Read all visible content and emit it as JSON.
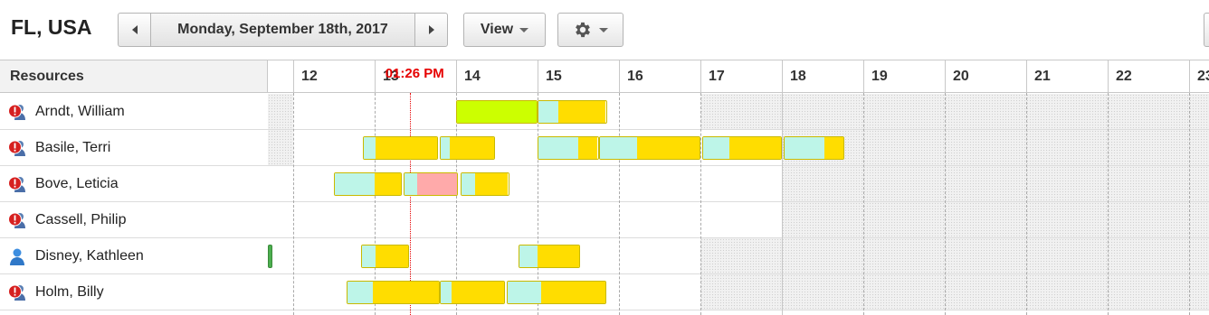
{
  "toolbar": {
    "location_title": "FL, USA",
    "prev_icon": "chevron-left-icon",
    "date_label": "Monday, September 18th, 2017",
    "next_icon": "chevron-right-icon",
    "view_label": "View",
    "settings_icon": "gear-icon"
  },
  "scheduler": {
    "resources_header": "Resources",
    "hours": [
      "12",
      "13",
      "14",
      "15",
      "16",
      "17",
      "18",
      "19",
      "20",
      "21",
      "22",
      "23"
    ],
    "now_label": "01:26 PM",
    "now_hour": 13.43,
    "colors": {
      "travel": "#bdf5e8",
      "work": "#ffdd00",
      "done": "#ccff00",
      "alert": "#ffaaaa",
      "marker": "#4caf50",
      "offhours": "#f1f1f1",
      "now_line": "#e60000"
    },
    "resources": [
      {
        "name": "Arndt, William",
        "icon": "alert-user-icon",
        "offhours": [
          [
            11.68,
            12.0
          ],
          [
            17.0,
            23.4
          ]
        ],
        "events": [
          {
            "start": 14.0,
            "end": 15.0,
            "parts": [
              {
                "kind": "done",
                "frac": 1.0
              }
            ]
          },
          {
            "start": 15.0,
            "end": 15.85,
            "parts": [
              {
                "kind": "travel",
                "frac": 0.29
              },
              {
                "kind": "work",
                "frac": 0.71
              }
            ]
          }
        ]
      },
      {
        "name": "Basile, Terri",
        "icon": "alert-user-icon",
        "offhours": [
          [
            11.68,
            12.0
          ],
          [
            18.0,
            23.4
          ]
        ],
        "events": [
          {
            "start": 12.85,
            "end": 13.78,
            "parts": [
              {
                "kind": "travel",
                "frac": 0.16
              },
              {
                "kind": "work",
                "frac": 0.84
              }
            ]
          },
          {
            "start": 13.8,
            "end": 14.48,
            "parts": [
              {
                "kind": "travel",
                "frac": 0.17
              },
              {
                "kind": "work",
                "frac": 0.83
              }
            ]
          },
          {
            "start": 15.0,
            "end": 15.75,
            "parts": [
              {
                "kind": "travel",
                "frac": 0.67
              },
              {
                "kind": "work",
                "frac": 0.33
              }
            ]
          },
          {
            "start": 15.75,
            "end": 17.0,
            "parts": [
              {
                "kind": "travel",
                "frac": 0.38
              },
              {
                "kind": "work",
                "frac": 0.62
              }
            ]
          },
          {
            "start": 17.02,
            "end": 18.0,
            "parts": [
              {
                "kind": "travel",
                "frac": 0.34
              },
              {
                "kind": "work",
                "frac": 0.66
              }
            ]
          },
          {
            "start": 18.02,
            "end": 18.77,
            "parts": [
              {
                "kind": "travel",
                "frac": 0.68
              },
              {
                "kind": "work",
                "frac": 0.32
              }
            ]
          }
        ]
      },
      {
        "name": "Bove, Leticia",
        "icon": "alert-user-icon",
        "offhours": [
          [
            18.0,
            23.4
          ]
        ],
        "events": [
          {
            "start": 12.5,
            "end": 13.33,
            "parts": [
              {
                "kind": "travel",
                "frac": 0.6
              },
              {
                "kind": "work",
                "frac": 0.4
              }
            ]
          },
          {
            "start": 13.35,
            "end": 14.02,
            "parts": [
              {
                "kind": "travel",
                "frac": 0.25
              },
              {
                "kind": "alert",
                "frac": 0.75
              }
            ]
          },
          {
            "start": 14.05,
            "end": 14.65,
            "parts": [
              {
                "kind": "travel",
                "frac": 0.3
              },
              {
                "kind": "work",
                "frac": 0.7
              }
            ]
          }
        ]
      },
      {
        "name": "Cassell, Philip",
        "icon": "alert-user-icon",
        "offhours": [
          [
            18.0,
            23.4
          ]
        ],
        "events": []
      },
      {
        "name": "Disney, Kathleen",
        "icon": "user-icon",
        "offhours": [
          [
            17.0,
            23.4
          ]
        ],
        "events": [
          {
            "start": 12.83,
            "end": 13.42,
            "parts": [
              {
                "kind": "travel",
                "frac": 0.29
              },
              {
                "kind": "work",
                "frac": 0.71
              }
            ]
          },
          {
            "start": 14.77,
            "end": 15.52,
            "parts": [
              {
                "kind": "travel",
                "frac": 0.3
              },
              {
                "kind": "work",
                "frac": 0.7
              }
            ]
          }
        ],
        "markers": [
          11.68
        ]
      },
      {
        "name": "Holm, Billy",
        "icon": "alert-user-icon",
        "offhours": [
          [
            17.0,
            23.4
          ]
        ],
        "events": [
          {
            "start": 12.65,
            "end": 13.8,
            "parts": [
              {
                "kind": "travel",
                "frac": 0.28
              },
              {
                "kind": "work",
                "frac": 0.72
              }
            ]
          },
          {
            "start": 13.8,
            "end": 14.6,
            "parts": [
              {
                "kind": "travel",
                "frac": 0.17
              },
              {
                "kind": "work",
                "frac": 0.83
              }
            ]
          },
          {
            "start": 14.62,
            "end": 15.85,
            "parts": [
              {
                "kind": "travel",
                "frac": 0.34
              },
              {
                "kind": "work",
                "frac": 0.66
              }
            ]
          }
        ]
      }
    ]
  }
}
